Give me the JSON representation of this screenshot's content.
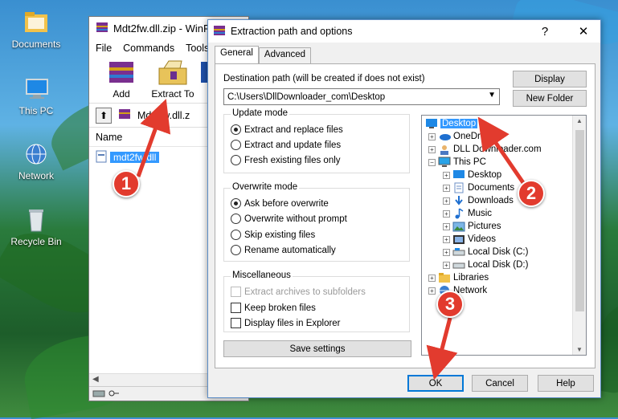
{
  "desktop": {
    "icons": [
      {
        "label": "Documents",
        "icon": "folder-icon"
      },
      {
        "label": "This PC",
        "icon": "computer-icon"
      },
      {
        "label": "Network",
        "icon": "network-icon"
      },
      {
        "label": "Recycle Bin",
        "icon": "recycle-bin-icon"
      }
    ]
  },
  "winrar": {
    "title": "Mdt2fw.dll.zip - WinR",
    "menu": [
      "File",
      "Commands",
      "Tools"
    ],
    "toolbar": [
      {
        "label": "Add",
        "icon": "add-archive-icon"
      },
      {
        "label": "Extract To",
        "icon": "extract-to-icon"
      }
    ],
    "path": "Mdt2fw.dll.z",
    "column_name": "Name",
    "file": "mdt2fw.dll"
  },
  "dialog": {
    "title": "Extraction path and options",
    "help": "?",
    "close": "✕",
    "tabs": [
      "General",
      "Advanced"
    ],
    "dest_label": "Destination path (will be created if does not exist)",
    "dest_value": "C:\\Users\\DllDownloader_com\\Desktop",
    "display_button": "Display",
    "new_folder_button": "New Folder",
    "update_mode": {
      "title": "Update mode",
      "options": [
        "Extract and replace files",
        "Extract and update files",
        "Fresh existing files only"
      ],
      "selected": 0
    },
    "overwrite_mode": {
      "title": "Overwrite mode",
      "options": [
        "Ask before overwrite",
        "Overwrite without prompt",
        "Skip existing files",
        "Rename automatically"
      ],
      "selected": 0
    },
    "misc": {
      "title": "Miscellaneous",
      "options": [
        "Extract archives to subfolders",
        "Keep broken files",
        "Display files in Explorer"
      ],
      "checked": [
        false,
        false,
        false
      ],
      "disabled": [
        true,
        false,
        false
      ]
    },
    "save_settings": "Save settings",
    "tree": [
      {
        "label": "Desktop",
        "icon": "desktop-icon",
        "selected": true
      },
      {
        "label": "OneDrive",
        "icon": "onedrive-icon"
      },
      {
        "label": "DLL Downloader.com",
        "icon": "user-icon"
      },
      {
        "label": "This PC",
        "icon": "computer-icon"
      },
      {
        "label": "Desktop",
        "icon": "desktop-icon"
      },
      {
        "label": "Documents",
        "icon": "documents-icon"
      },
      {
        "label": "Downloads",
        "icon": "downloads-icon"
      },
      {
        "label": "Music",
        "icon": "music-icon"
      },
      {
        "label": "Pictures",
        "icon": "pictures-icon"
      },
      {
        "label": "Videos",
        "icon": "videos-icon"
      },
      {
        "label": "Local Disk (C:)",
        "icon": "drive-icon"
      },
      {
        "label": "Local Disk (D:)",
        "icon": "drive-icon"
      },
      {
        "label": "Libraries",
        "icon": "libraries-icon"
      },
      {
        "label": "Network",
        "icon": "network-icon"
      }
    ],
    "ok": "OK",
    "cancel": "Cancel",
    "help_button": "Help"
  },
  "markers": [
    "1",
    "2",
    "3"
  ],
  "colors": {
    "marker": "#e23b2e",
    "selection": "#3399ff",
    "focus": "#0078d7"
  }
}
